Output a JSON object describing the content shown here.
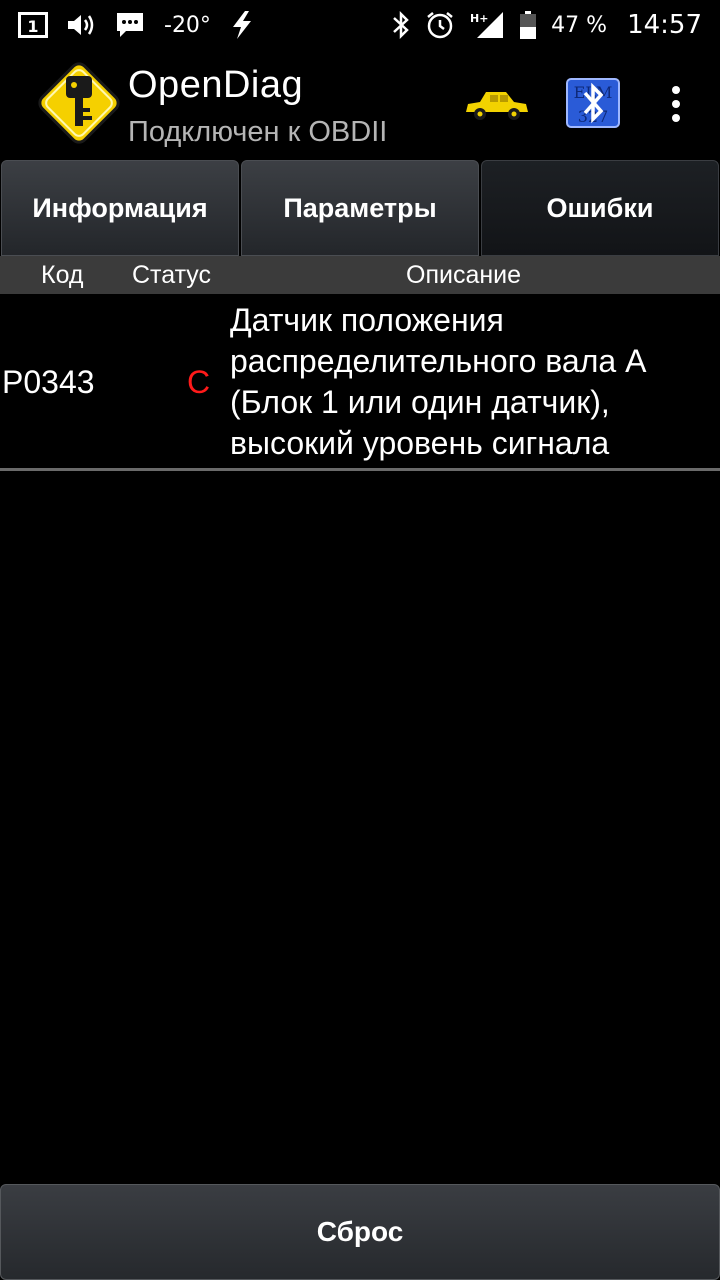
{
  "status_bar": {
    "notification_count": "1",
    "temperature": "-20°",
    "battery": "47 %",
    "time": "14:57",
    "network": "H+"
  },
  "app_bar": {
    "title": "OpenDiag",
    "subtitle": "Подключен к OBDII",
    "bt_badge_top": "ELM",
    "bt_badge_bottom": "327"
  },
  "tabs": [
    {
      "label": "Информация",
      "active": false
    },
    {
      "label": "Параметры",
      "active": false
    },
    {
      "label": "Ошибки",
      "active": true
    }
  ],
  "table": {
    "headers": {
      "code": "Код",
      "status": "Статус",
      "description": "Описание"
    },
    "rows": [
      {
        "code": "P0343",
        "status": "C",
        "description": "Датчик положения распределительного вала A (Блок 1 или один датчик), высокий уровень сигнала"
      }
    ]
  },
  "reset_button": {
    "label": "Сброс"
  },
  "colors": {
    "status_color": "#ff1a1a",
    "logo_yellow": "#f5d000",
    "car_yellow": "#f2d200",
    "bt_blue": "#2a5bd7"
  }
}
